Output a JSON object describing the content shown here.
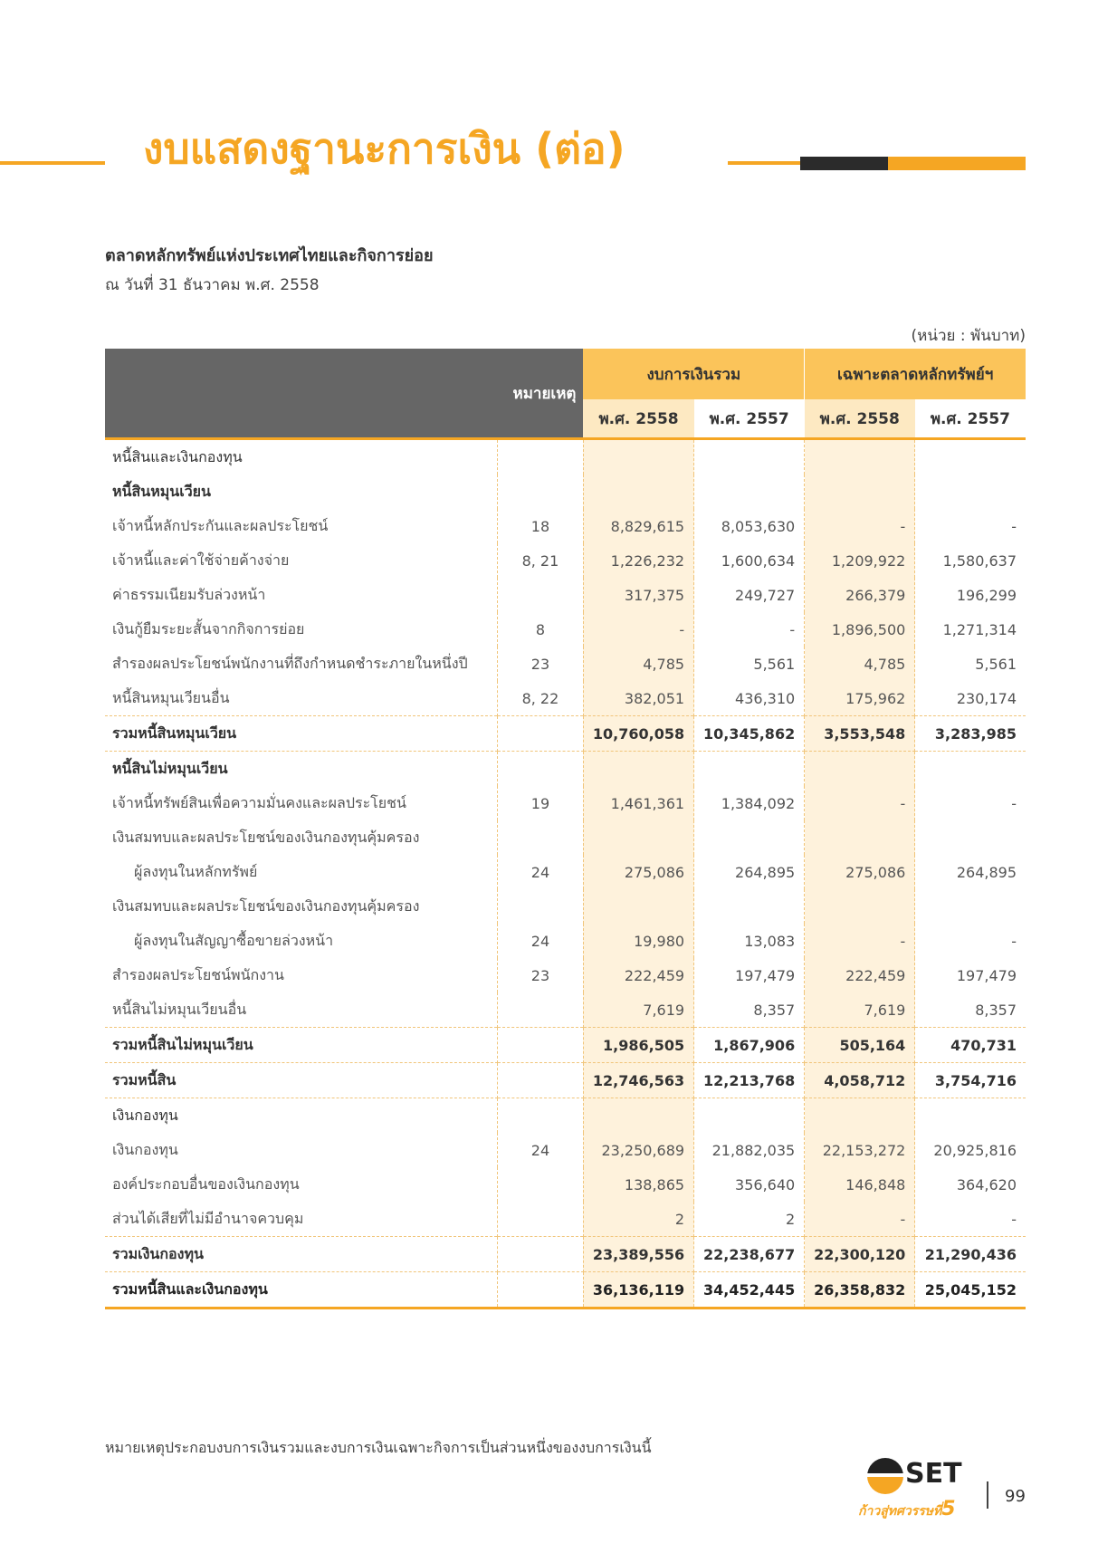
{
  "title": "งบแสดงฐานะการเงิน (ต่อ)",
  "company": "ตลาดหลักทรัพย์แห่งประเทศไทยและกิจการย่อย",
  "as_of": "ณ วันที่ 31 ธันวาคม พ.ศ. 2558",
  "unit": "(หน่วย : พันบาท)",
  "headers": {
    "note": "หมายเหตุ",
    "consolidated": "งบการเงินรวม",
    "separate": "เฉพาะตลาดหลักทรัพย์ฯ",
    "years": [
      "พ.ศ. 2558",
      "พ.ศ. 2557",
      "พ.ศ. 2558",
      "พ.ศ. 2557"
    ]
  },
  "rows": [
    {
      "label": "หนี้สินและเงินกองทุน",
      "note": "",
      "v": [
        "",
        "",
        "",
        ""
      ]
    },
    {
      "label": "หนี้สินหมุนเวียน",
      "note": "",
      "v": [
        "",
        "",
        "",
        ""
      ]
    },
    {
      "label": "เจ้าหนี้หลักประกันและผลประโยชน์",
      "note": "18",
      "v": [
        "8,829,615",
        "8,053,630",
        "-",
        "-"
      ]
    },
    {
      "label": "เจ้าหนี้และค่าใช้จ่ายค้างจ่าย",
      "note": "8, 21",
      "v": [
        "1,226,232",
        "1,600,634",
        "1,209,922",
        "1,580,637"
      ]
    },
    {
      "label": "ค่าธรรมเนียมรับล่วงหน้า",
      "note": "",
      "v": [
        "317,375",
        "249,727",
        "266,379",
        "196,299"
      ]
    },
    {
      "label": "เงินกู้ยืมระยะสั้นจากกิจการย่อย",
      "note": "8",
      "v": [
        "-",
        "-",
        "1,896,500",
        "1,271,314"
      ]
    },
    {
      "label": "สำรองผลประโยชน์พนักงานที่ถึงกำหนดชำระภายในหนึ่งปี",
      "note": "23",
      "v": [
        "4,785",
        "5,561",
        "4,785",
        "5,561"
      ]
    },
    {
      "label": "หนี้สินหมุนเวียนอื่น",
      "note": "8, 22",
      "v": [
        "382,051",
        "436,310",
        "175,962",
        "230,174"
      ]
    },
    {
      "label": "รวมหนี้สินหมุนเวียน",
      "note": "",
      "v": [
        "10,760,058",
        "10,345,862",
        "3,553,548",
        "3,283,985"
      ]
    },
    {
      "label": "หนี้สินไม่หมุนเวียน",
      "note": "",
      "v": [
        "",
        "",
        "",
        ""
      ]
    },
    {
      "label": "เจ้าหนี้ทรัพย์สินเพื่อความมั่นคงและผลประโยชน์",
      "note": "19",
      "v": [
        "1,461,361",
        "1,384,092",
        "-",
        "-"
      ]
    },
    {
      "label": "เงินสมทบและผลประโยชน์ของเงินกองทุนคุ้มครอง",
      "note": "",
      "v": [
        "",
        "",
        "",
        ""
      ]
    },
    {
      "label": "ผู้ลงทุนในหลักทรัพย์",
      "note": "24",
      "v": [
        "275,086",
        "264,895",
        "275,086",
        "264,895"
      ]
    },
    {
      "label": "เงินสมทบและผลประโยชน์ของเงินกองทุนคุ้มครอง",
      "note": "",
      "v": [
        "",
        "",
        "",
        ""
      ]
    },
    {
      "label": "ผู้ลงทุนในสัญญาซื้อขายล่วงหน้า",
      "note": "24",
      "v": [
        "19,980",
        "13,083",
        "-",
        "-"
      ]
    },
    {
      "label": "สำรองผลประโยชน์พนักงาน",
      "note": "23",
      "v": [
        "222,459",
        "197,479",
        "222,459",
        "197,479"
      ]
    },
    {
      "label": "หนี้สินไม่หมุนเวียนอื่น",
      "note": "",
      "v": [
        "7,619",
        "8,357",
        "7,619",
        "8,357"
      ]
    },
    {
      "label": "รวมหนี้สินไม่หมุนเวียน",
      "note": "",
      "v": [
        "1,986,505",
        "1,867,906",
        "505,164",
        "470,731"
      ]
    },
    {
      "label": "รวมหนี้สิน",
      "note": "",
      "v": [
        "12,746,563",
        "12,213,768",
        "4,058,712",
        "3,754,716"
      ]
    },
    {
      "label": "เงินกองทุน",
      "note": "",
      "v": [
        "",
        "",
        "",
        ""
      ]
    },
    {
      "label": "เงินกองทุน",
      "note": "24",
      "v": [
        "23,250,689",
        "21,882,035",
        "22,153,272",
        "20,925,816"
      ]
    },
    {
      "label": "องค์ประกอบอื่นของเงินกองทุน",
      "note": "",
      "v": [
        "138,865",
        "356,640",
        "146,848",
        "364,620"
      ]
    },
    {
      "label": "ส่วนได้เสียที่ไม่มีอำนาจควบคุม",
      "note": "",
      "v": [
        "2",
        "2",
        "-",
        "-"
      ]
    },
    {
      "label": "รวมเงินกองทุน",
      "note": "",
      "v": [
        "23,389,556",
        "22,238,677",
        "22,300,120",
        "21,290,436"
      ]
    },
    {
      "label": "รวมหนี้สินและเงินกองทุน",
      "note": "",
      "v": [
        "36,136,119",
        "34,452,445",
        "26,358,832",
        "25,045,152"
      ]
    }
  ],
  "footnote": "หมายเหตุประกอบงบการเงินรวมและงบการเงินเฉพาะกิจการเป็นส่วนหนึ่งของงบการเงินนี้",
  "logo": {
    "brand": "SET",
    "tagline": "ก้าวสู่ทศวรรษที่",
    "tagline_num": "5"
  },
  "page_number": "99",
  "colors": {
    "accent": "#f5a623",
    "header_gray": "#666666",
    "dark_bar": "#2b2b2b"
  }
}
